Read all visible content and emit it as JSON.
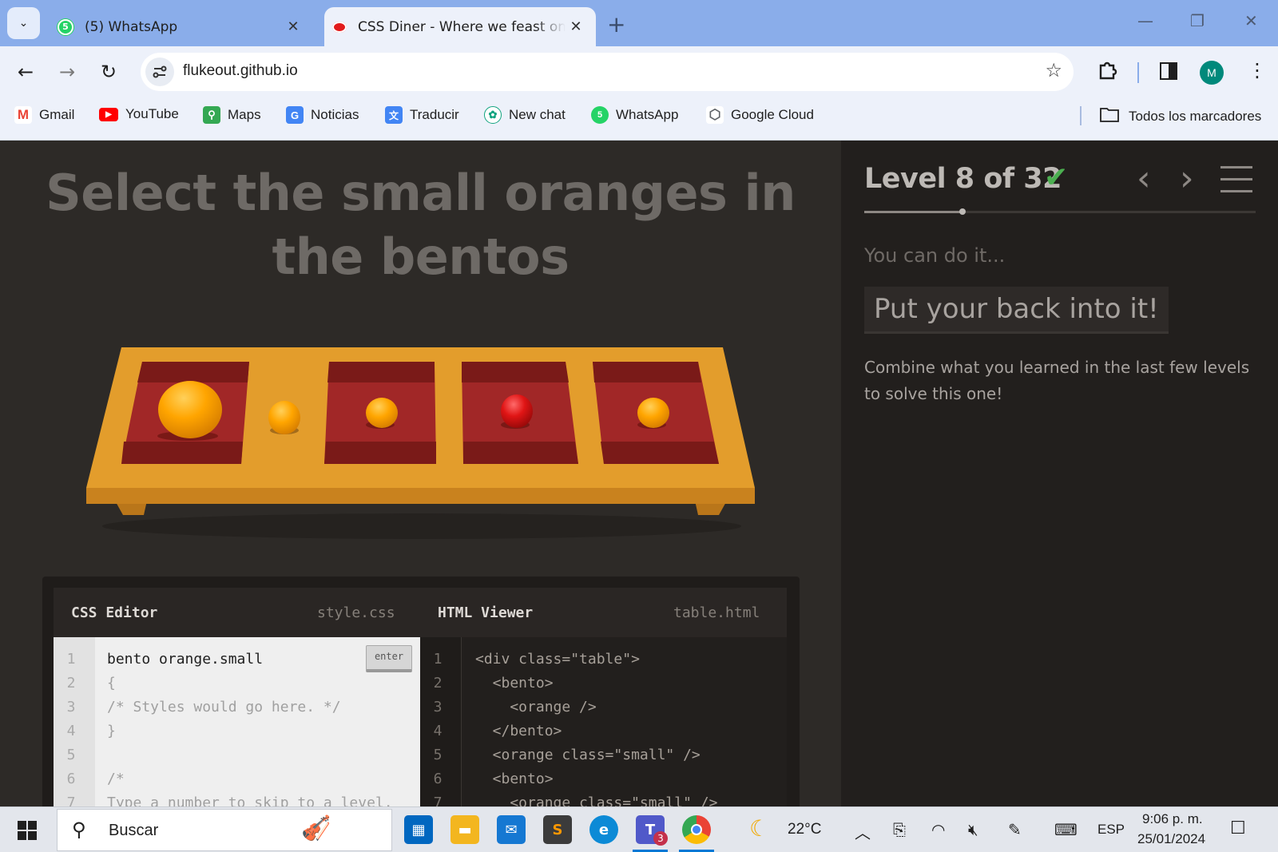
{
  "browser": {
    "tabs": [
      {
        "title": "(5) WhatsApp",
        "active": false,
        "close": "✕"
      },
      {
        "title": "CSS Diner - Where we feast on CSS Selectors!",
        "active": true,
        "close": "✕"
      }
    ],
    "new_tab": "+",
    "window_controls": {
      "minimize": "—",
      "restore": "❐",
      "close": "✕"
    },
    "nav": {
      "back": "←",
      "forward": "→",
      "reload": "↻"
    },
    "url": "flukeout.github.io",
    "profile_initial": "M",
    "bookmarks": [
      {
        "label": "Gmail",
        "icon": "gmail-icon",
        "color": "#ea4335",
        "glyph": "M"
      },
      {
        "label": "YouTube",
        "icon": "youtube-icon",
        "color": "#ff0000",
        "glyph": "▶"
      },
      {
        "label": "Maps",
        "icon": "maps-icon",
        "color": "#34a853",
        "glyph": "⚲"
      },
      {
        "label": "Noticias",
        "icon": "news-icon",
        "color": "#4285f4",
        "glyph": "G"
      },
      {
        "label": "Traducir",
        "icon": "translate-icon",
        "color": "#4285f4",
        "glyph": "文"
      },
      {
        "label": "New chat",
        "icon": "chatgpt-icon",
        "color": "#10a37f",
        "glyph": "✿"
      },
      {
        "label": "WhatsApp",
        "icon": "whatsapp-icon",
        "color": "#25d366",
        "glyph": "5"
      },
      {
        "label": "Google Cloud",
        "icon": "cloud-icon",
        "color": "#5f6368",
        "glyph": "⬡"
      }
    ],
    "all_bookmarks": "Todos los marcadores"
  },
  "game": {
    "instruction": "Select the small oranges in the bentos",
    "colors": {
      "table": "#e39d2c",
      "bento": "#a12727",
      "orange": "#ffa500",
      "apple": "#d11414"
    },
    "css_editor": {
      "title": "CSS Editor",
      "file": "style.css",
      "enter_label": "enter",
      "line_numbers": [
        "1",
        "2",
        "3",
        "4",
        "5",
        "6",
        "7"
      ],
      "lines": [
        "bento orange.small",
        "{",
        "/* Styles would go here. */",
        "}",
        "",
        "/*",
        "Type a number to skip to a level."
      ]
    },
    "html_viewer": {
      "title": "HTML Viewer",
      "file": "table.html",
      "line_numbers": [
        "1",
        "2",
        "3",
        "4",
        "5",
        "6",
        "7"
      ],
      "lines": [
        "<div class=\"table\">",
        "  <bento>",
        "    <orange />",
        "  </bento>",
        "  <orange class=\"small\" />",
        "  <bento>",
        "    <orange class=\"small\" />"
      ]
    }
  },
  "sidebar": {
    "level_title": "Level 8 of 32",
    "check": "✔",
    "prev": "‹",
    "next": "›",
    "progress": 0.25,
    "subtitle": "You can do it...",
    "selector_name": "Put your back into it!",
    "syntax": "Combine what you learned in the last few levels to solve this one!"
  },
  "taskbar": {
    "search_placeholder": "Buscar",
    "weather": "22°C",
    "language": "ESP",
    "time": "9:06 p. m.",
    "date": "25/01/2024",
    "teams_badge": "3"
  }
}
